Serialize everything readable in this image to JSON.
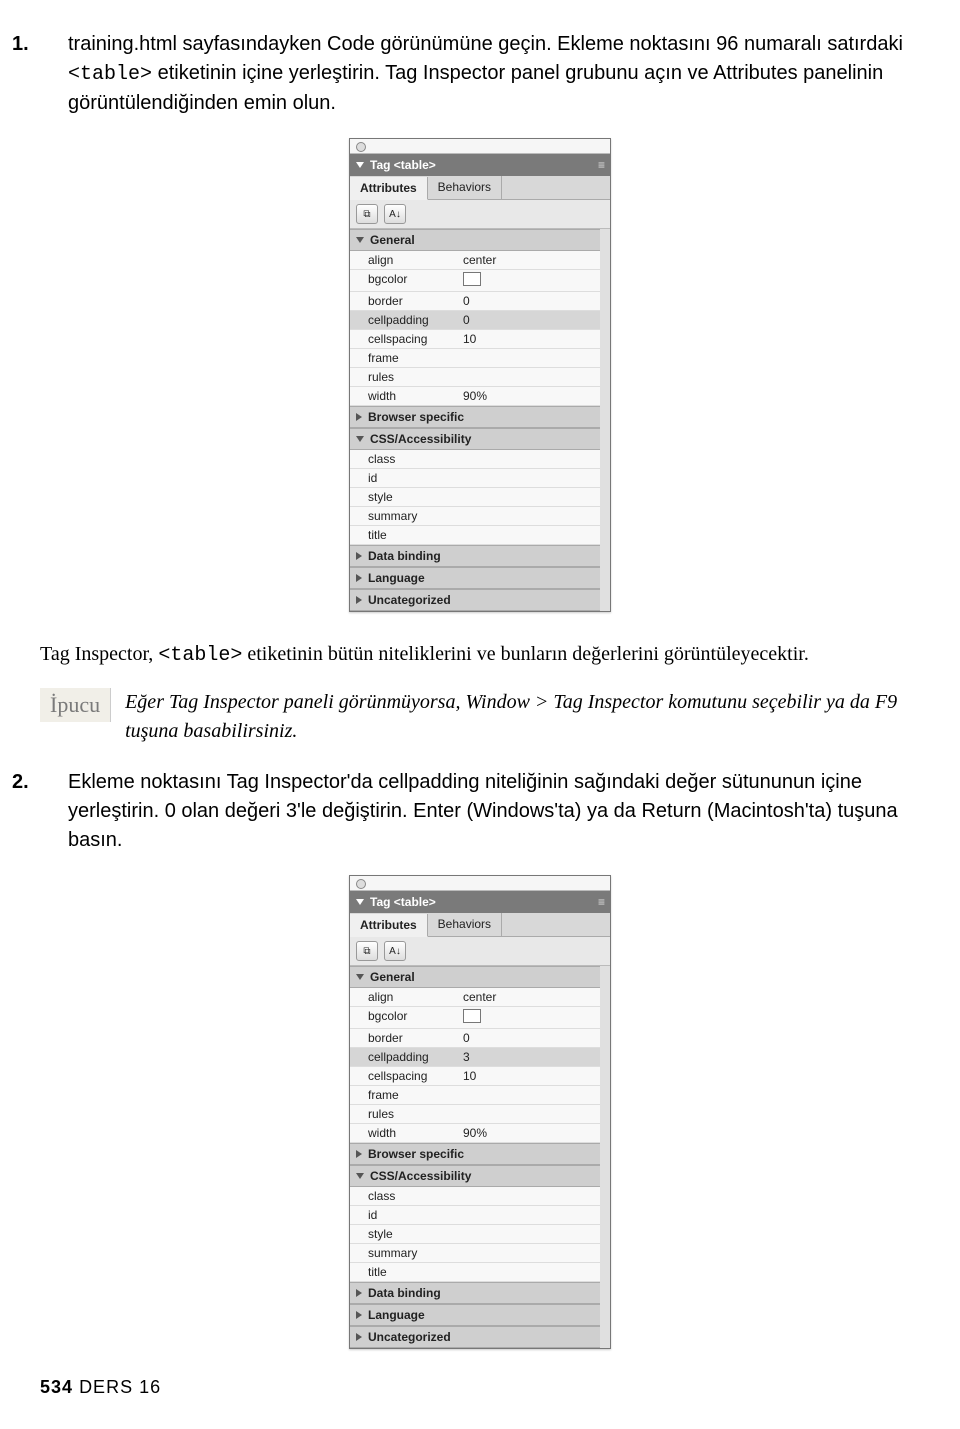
{
  "step1": {
    "num": "1.",
    "text_a": "training.html sayfasındayken Code görünümüne geçin. Ekleme noktasını 96 numaralı satırdaki ",
    "code": "<table>",
    "text_b": " etiketinin içine yerleştirin. Tag Inspector panel grubunu açın ve Attributes panelinin görüntülendiğinden emin olun."
  },
  "panel": {
    "title": "Tag <table>",
    "tab_attributes": "Attributes",
    "tab_behaviors": "Behaviors",
    "toolbar_sort": "A↓",
    "sections": {
      "general": "General",
      "browser": "Browser specific",
      "css": "CSS/Accessibility",
      "data": "Data binding",
      "lang": "Language",
      "uncat": "Uncategorized"
    },
    "general_rows": [
      {
        "k": "align",
        "v": "center"
      },
      {
        "k": "bgcolor",
        "v": ""
      },
      {
        "k": "border",
        "v": "0"
      },
      {
        "k": "cellpadding",
        "v": "0"
      },
      {
        "k": "cellspacing",
        "v": "10"
      },
      {
        "k": "frame",
        "v": ""
      },
      {
        "k": "rules",
        "v": ""
      },
      {
        "k": "width",
        "v": "90%"
      }
    ],
    "css_rows": [
      {
        "k": "class",
        "v": ""
      },
      {
        "k": "id",
        "v": ""
      },
      {
        "k": "style",
        "v": ""
      },
      {
        "k": "summary",
        "v": ""
      },
      {
        "k": "title",
        "v": ""
      }
    ]
  },
  "panel2_cellpadding": "3",
  "body_after_panel": {
    "a": "Tag Inspector, ",
    "code": "<table>",
    "b": " etiketinin bütün niteliklerini ve bunların değerlerini görüntüleyecektir."
  },
  "tip": {
    "label": "İpucu",
    "text": "Eğer Tag Inspector paneli görünmüyorsa, Window > Tag Inspector komutunu seçebilir ya da F9 tuşuna basabilirsiniz."
  },
  "step2": {
    "num": "2.",
    "text": "Ekleme noktasını Tag Inspector'da cellpadding niteliğinin sağındaki değer sütununun içine yerleştirin. 0 olan değeri 3'le değiştirin. Enter (Windows'ta) ya da Return (Macintosh'ta) tuşuna basın."
  },
  "footer": {
    "page": "534",
    "chapter": "DERS 16"
  }
}
